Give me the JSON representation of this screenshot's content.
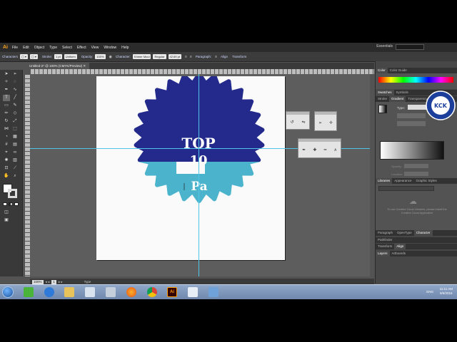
{
  "app": {
    "logo": "Ai",
    "menus": [
      "File",
      "Edit",
      "Object",
      "Type",
      "Select",
      "Effect",
      "View",
      "Window",
      "Help"
    ],
    "workspace": "Essentials"
  },
  "control": {
    "selection_label": "Characters",
    "stroke_label": "Stroke:",
    "stroke_value": "1 pt",
    "profile_value": "Uniform",
    "opacity_label": "Opacity:",
    "opacity_value": "100%",
    "character_label": "Character:",
    "font_value": "Khmer Moul",
    "style_value": "Regular",
    "size_value": "42.69 pt",
    "paragraph_label": "Paragraph:",
    "align_label": "Align",
    "transform_label": "Transform"
  },
  "document": {
    "tab_title": "Untitled-2* @ 100% (CMYK/Preview)"
  },
  "artwork": {
    "line1": "TOP",
    "line2": "10",
    "line3": "Pa",
    "colors": {
      "dark_blue": "#232a8c",
      "light_blue": "#4bb4cc",
      "text": "#ffffff"
    }
  },
  "status": {
    "zoom": "100%",
    "page": "1",
    "tool": "Type"
  },
  "panels": {
    "color_tabs": [
      "Color",
      "Color Guide"
    ],
    "swatch_tabs": [
      "Swatches",
      "Symbols"
    ],
    "stroke_tabs": [
      "Stroke",
      "Gradient",
      "Transparency"
    ],
    "gradient_type_label": "Type:",
    "gradient_opacity_label": "Opacity:",
    "gradient_location_label": "Location:",
    "library_tabs": [
      "Libraries",
      "Appearance",
      "Graphic Styles"
    ],
    "library_message": "To use Creative Cloud Libraries, please install the Creative Cloud Application",
    "paragraph_tabs": [
      "Paragraph",
      "OpenType",
      "Character"
    ],
    "pathfinder_tab": "Pathfinder",
    "transform_tabs": [
      "Transform",
      "Align"
    ],
    "layers_tabs": [
      "Layers",
      "Artboards"
    ]
  },
  "taskbar": {
    "lang": "ENG",
    "time": "11:11 AM",
    "date": "9/6/2016"
  },
  "watermark": {
    "text": "KCK"
  }
}
